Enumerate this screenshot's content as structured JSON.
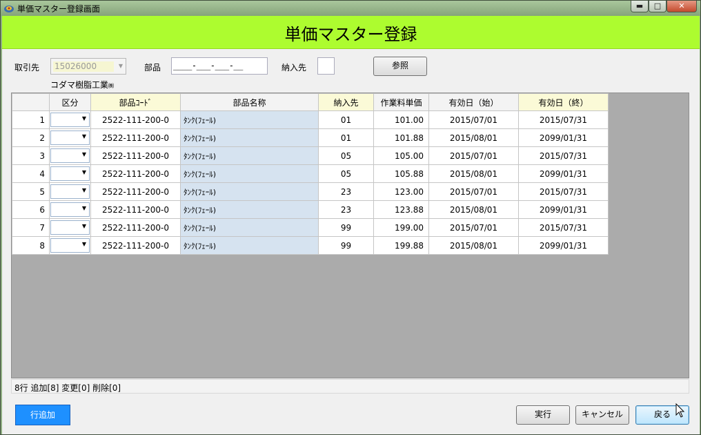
{
  "window": {
    "title": "単価マスター登録画面",
    "minimize": "▬",
    "maximize": "□",
    "close": "✕"
  },
  "header": {
    "title": "単価マスター登録"
  },
  "filters": {
    "supplier_label": "取引先",
    "supplier_value": "15026000",
    "supplier_name": "コダマ樹脂工業",
    "supplier_suffix": "㈱",
    "part_label": "部品",
    "part_value": "____-___-___-__",
    "dest_label": "納入先",
    "dest_value": "",
    "ref_button": "参照"
  },
  "grid": {
    "columns": [
      "",
      "区分",
      "部品ｺｰﾄﾞ",
      "部品名称",
      "納入先",
      "作業料単価",
      "有効日（始）",
      "有効日（終）"
    ],
    "rows": [
      {
        "no": "1",
        "kubun": "",
        "code": "2522-111-200-0",
        "name": "ﾀﾝｸ(ﾌｪｰﾙ)",
        "dest": "01",
        "price": "101.00",
        "start": "2015/07/01",
        "end": "2015/07/31"
      },
      {
        "no": "2",
        "kubun": "",
        "code": "2522-111-200-0",
        "name": "ﾀﾝｸ(ﾌｪｰﾙ)",
        "dest": "01",
        "price": "101.88",
        "start": "2015/08/01",
        "end": "2099/01/31"
      },
      {
        "no": "3",
        "kubun": "",
        "code": "2522-111-200-0",
        "name": "ﾀﾝｸ(ﾌｪｰﾙ)",
        "dest": "05",
        "price": "105.00",
        "start": "2015/07/01",
        "end": "2015/07/31"
      },
      {
        "no": "4",
        "kubun": "",
        "code": "2522-111-200-0",
        "name": "ﾀﾝｸ(ﾌｪｰﾙ)",
        "dest": "05",
        "price": "105.88",
        "start": "2015/08/01",
        "end": "2099/01/31"
      },
      {
        "no": "5",
        "kubun": "",
        "code": "2522-111-200-0",
        "name": "ﾀﾝｸ(ﾌｪｰﾙ)",
        "dest": "23",
        "price": "123.00",
        "start": "2015/07/01",
        "end": "2015/07/31"
      },
      {
        "no": "6",
        "kubun": "",
        "code": "2522-111-200-0",
        "name": "ﾀﾝｸ(ﾌｪｰﾙ)",
        "dest": "23",
        "price": "123.88",
        "start": "2015/08/01",
        "end": "2099/01/31"
      },
      {
        "no": "7",
        "kubun": "",
        "code": "2522-111-200-0",
        "name": "ﾀﾝｸ(ﾌｪｰﾙ)",
        "dest": "99",
        "price": "199.00",
        "start": "2015/07/01",
        "end": "2015/07/31"
      },
      {
        "no": "8",
        "kubun": "",
        "code": "2522-111-200-0",
        "name": "ﾀﾝｸ(ﾌｪｰﾙ)",
        "dest": "99",
        "price": "199.88",
        "start": "2015/08/01",
        "end": "2099/01/31"
      }
    ]
  },
  "status": {
    "text": "8行  追加[8]  変更[0]  削除[0]"
  },
  "buttons": {
    "add_row": "行追加",
    "execute": "実行",
    "cancel": "キャンセル",
    "back": "戻る"
  },
  "colors": {
    "header_band": "#adfc2f",
    "add_button": "#1e90ff",
    "name_cell": "#d6e3f0",
    "header_highlight": "#fbfad7"
  }
}
